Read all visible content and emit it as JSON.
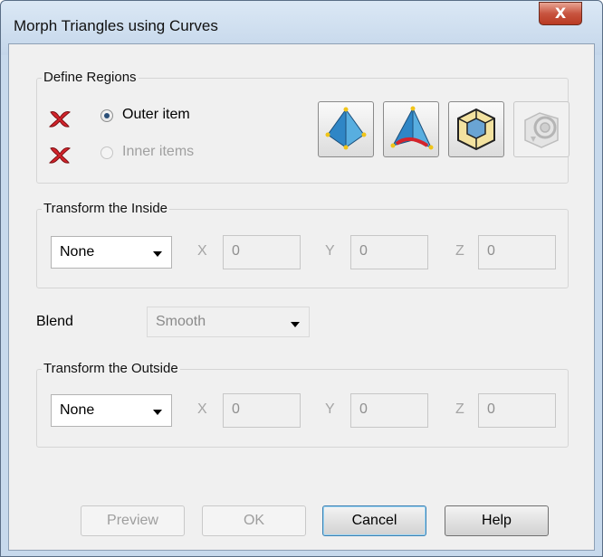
{
  "window": {
    "title": "Morph Triangles using Curves",
    "close_glyph": "X"
  },
  "define_regions": {
    "title": "Define Regions",
    "outer_item": {
      "label": "Outer item",
      "selected": true,
      "enabled": true
    },
    "inner_items": {
      "label": "Inner items",
      "selected": false,
      "enabled": false
    },
    "status_icon": "red-x-icon",
    "tool_icons": [
      "pyramid-blue-icon",
      "pyramid-red-curve-icon",
      "cube-box-icon",
      "target-gear-icon"
    ]
  },
  "transform_inside": {
    "title": "Transform the Inside",
    "mode": "None",
    "x_label": "X",
    "x_value": "0",
    "y_label": "Y",
    "y_value": "0",
    "z_label": "Z",
    "z_value": "0"
  },
  "blend": {
    "label": "Blend",
    "value": "Smooth"
  },
  "transform_outside": {
    "title": "Transform the Outside",
    "mode": "None",
    "x_label": "X",
    "x_value": "0",
    "y_label": "Y",
    "y_value": "0",
    "z_label": "Z",
    "z_value": "0"
  },
  "buttons": {
    "preview": "Preview",
    "ok": "OK",
    "cancel": "Cancel",
    "help": "Help"
  },
  "colors": {
    "accent_red": "#d4232b",
    "icon_blue": "#3a8fc9",
    "titlebar": "#c7d9ec"
  }
}
